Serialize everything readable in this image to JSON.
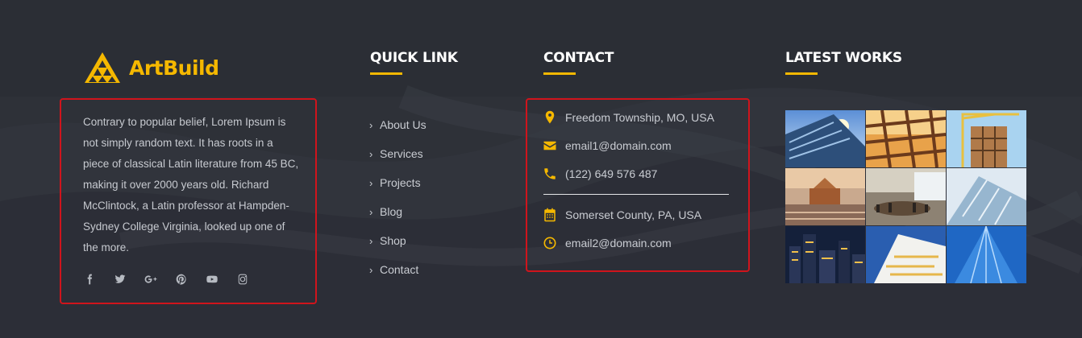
{
  "logo": {
    "name": "ArtBuild",
    "icon": "pyramid-logo-icon",
    "color": "#f5b800"
  },
  "about": {
    "text": "Contrary to popular belief, Lorem Ipsum is not simply random text. It has roots in a piece of classical Latin literature from 45 BC, making it over 2000 years old. Richard McClintock, a Latin professor at Hampden-Sydney College Virginia, looked up one of the more.",
    "socials": [
      "facebook-icon",
      "twitter-icon",
      "google-plus-icon",
      "pinterest-icon",
      "youtube-icon",
      "instagram-icon"
    ]
  },
  "quick_link": {
    "title": "QUICK LINK",
    "items": [
      "About Us",
      "Services",
      "Projects",
      "Blog",
      "Shop",
      "Contact"
    ]
  },
  "contact": {
    "title": "CONTACT",
    "address1": "Freedom Township, MO, USA",
    "email1": "email1@domain.com",
    "phone": "(122) 649 576 487",
    "address2": "Somerset County, PA, USA",
    "email2": "email2@domain.com",
    "icons": [
      "map-pin-icon",
      "envelope-icon",
      "phone-icon",
      "calendar-icon",
      "clock-icon"
    ]
  },
  "latest_works": {
    "title": "LATEST WORKS",
    "images": [
      "building-glass-tower-image",
      "construction-frame-image",
      "crane-construction-image",
      "city-aerial-image",
      "conference-room-image",
      "glass-facade-image",
      "city-night-image",
      "office-building-image",
      "skyscraper-blue-image"
    ]
  },
  "colors": {
    "accent": "#f5b800",
    "highlight_border": "#d0141c",
    "background": "#2e3138"
  }
}
